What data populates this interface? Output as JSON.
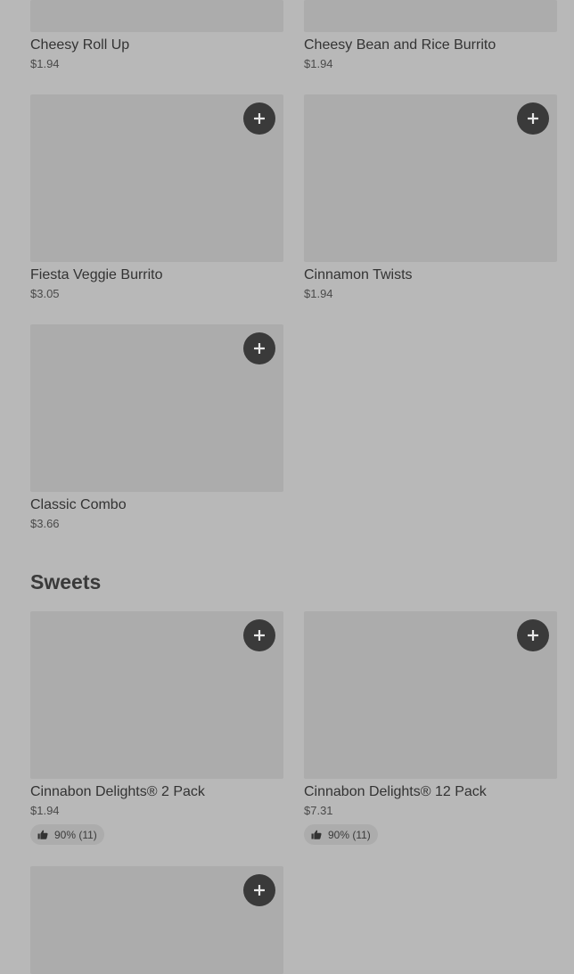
{
  "top_items": [
    {
      "name": "Cheesy Roll Up",
      "price": "$1.94"
    },
    {
      "name": "Cheesy Bean and Rice Burrito",
      "price": "$1.94"
    }
  ],
  "items": [
    {
      "name": "Fiesta Veggie Burrito",
      "price": "$3.05"
    },
    {
      "name": "Cinnamon Twists",
      "price": "$1.94"
    },
    {
      "name": "Classic Combo",
      "price": "$3.66"
    }
  ],
  "sweets": {
    "title": "Sweets",
    "items": [
      {
        "name": "Cinnabon Delights® 2 Pack",
        "price": "$1.94",
        "rating": "90% (11)"
      },
      {
        "name": "Cinnabon Delights® 12 Pack",
        "price": "$7.31",
        "rating": "90% (11)"
      }
    ]
  },
  "icons": {
    "add": "plus-icon",
    "rating": "thumbs-up-icon"
  },
  "colors": {
    "background": "#b8b8b8",
    "image_placeholder": "#acacac",
    "button": "#3a3a3a",
    "text": "#333333"
  }
}
